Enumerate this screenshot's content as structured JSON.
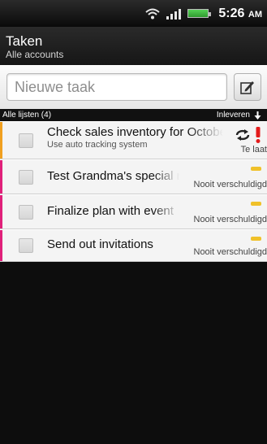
{
  "status_bar": {
    "time": "5:26",
    "ampm": "AM"
  },
  "header": {
    "title": "Taken",
    "subtitle": "Alle accounts"
  },
  "new_task": {
    "placeholder": "Nieuwe taak"
  },
  "list_header": {
    "list_label": "Alle lijsten (4)",
    "sort_label": "Inleveren"
  },
  "tasks": [
    {
      "title": "Check sales inventory for October",
      "note": "Use auto tracking system",
      "due": "Te laat",
      "priority_color": "#f0a020"
    },
    {
      "title": "Test Grandma's special recipe",
      "note": "",
      "due": "Nooit verschuldigd",
      "priority_color": "#e0207a"
    },
    {
      "title": "Finalize plan with event",
      "note": "",
      "due": "Nooit verschuldigd",
      "priority_color": "#e0207a"
    },
    {
      "title": "Send out invitations",
      "note": "",
      "due": "Nooit verschuldigd",
      "priority_color": "#e0207a"
    }
  ],
  "colors": {
    "accent_yellow": "#f0c12a",
    "overdue_red": "#e31b1b"
  }
}
